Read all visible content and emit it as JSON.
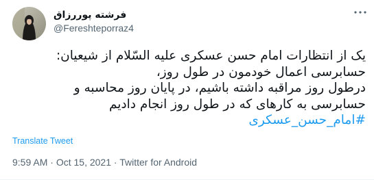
{
  "author": {
    "display_name": "فرشته پوررزاق",
    "handle": "@Fereshteporraz4",
    "avatar_icon": "avatar-image"
  },
  "menu_icon": "more-dots-icon",
  "tweet": {
    "lines": [
      "یک از انتظارات امام حسن عسکری علیه السّلام از شیعیان:",
      "حسابرسی  اعمال خودمون در طول روز،",
      "درطول روز مراقبه داشته باشیم، در پایان روز محاسبه و",
      "حسابرسی به کارهای که در طول روز انجام دادیم"
    ],
    "hashtag": "#امام_حسن_عسکری",
    "hashtag_color": "#1d9bf0"
  },
  "translate_label": "Translate Tweet",
  "meta": {
    "time": "9:59 AM",
    "separator1": " · ",
    "date": "Oct 15, 2021",
    "separator2": " · ",
    "source": "Twitter for Android"
  },
  "colors": {
    "text": "#0f1419",
    "secondary": "#536471",
    "link": "#1d9bf0"
  }
}
